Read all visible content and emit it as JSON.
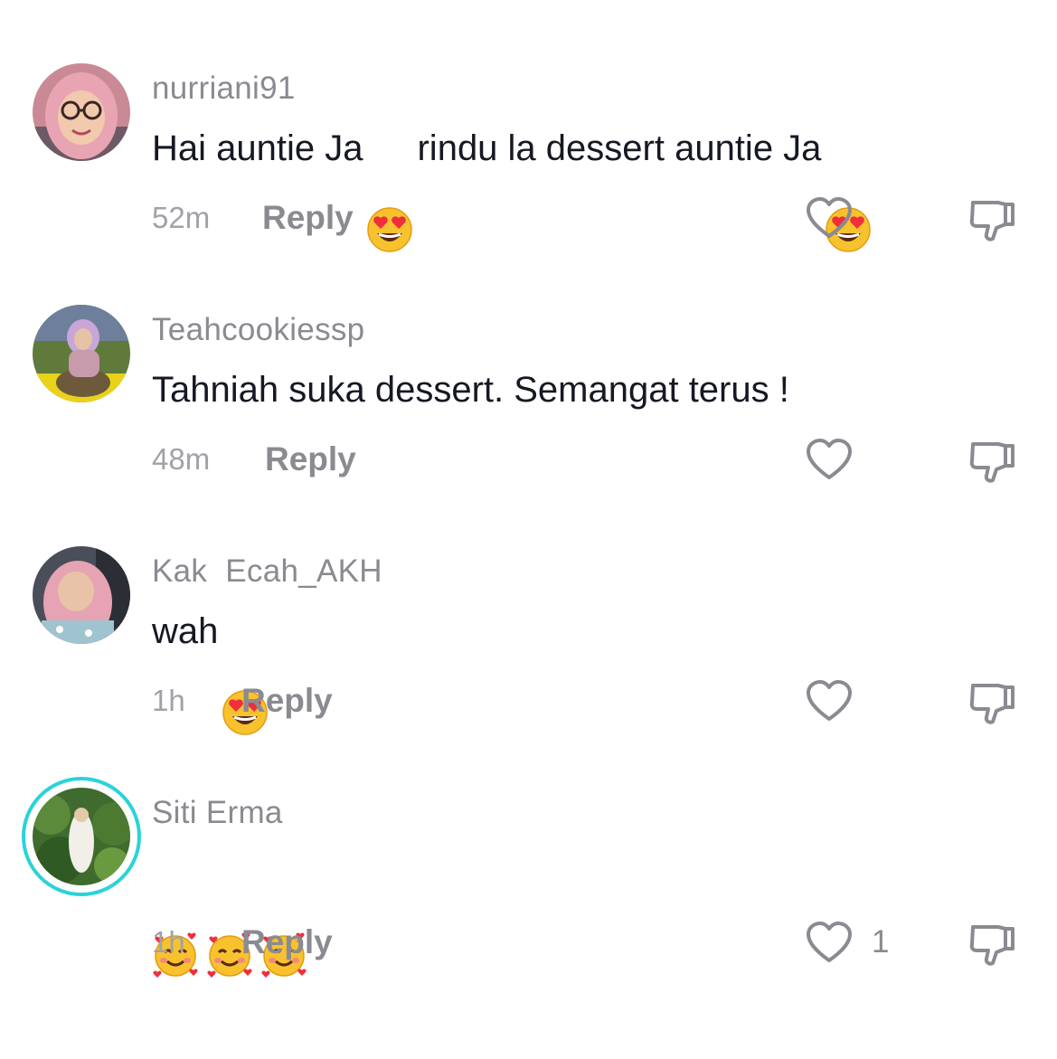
{
  "comments": [
    {
      "username": "nurriani91",
      "text_parts": [
        "Hai auntie Ja",
        "rindu la dessert auntie Ja"
      ],
      "emoji": "heart-eyes-emoji",
      "time": "52m",
      "reply": "Reply",
      "likes": ""
    },
    {
      "username": "Teahcookiessp",
      "text_parts": [
        "Tahniah suka dessert. Semangat terus !"
      ],
      "time": "48m",
      "reply": "Reply",
      "likes": ""
    },
    {
      "username": "Kak  Ecah_AKH",
      "text_parts": [
        "wah"
      ],
      "emoji": "heart-eyes-emoji",
      "time": "1h",
      "reply": "Reply",
      "likes": ""
    },
    {
      "username": "Siti Erma",
      "text_parts": [],
      "emoji": "smiling-face-with-hearts-emoji",
      "time": "1h",
      "reply": "Reply",
      "likes": "1"
    }
  ],
  "icons": {
    "like": "heart-outline-icon",
    "dislike": "thumbs-down-icon"
  },
  "colors": {
    "username": "#8a8b91",
    "text": "#161823",
    "story_ring": "#2ad3d8"
  }
}
